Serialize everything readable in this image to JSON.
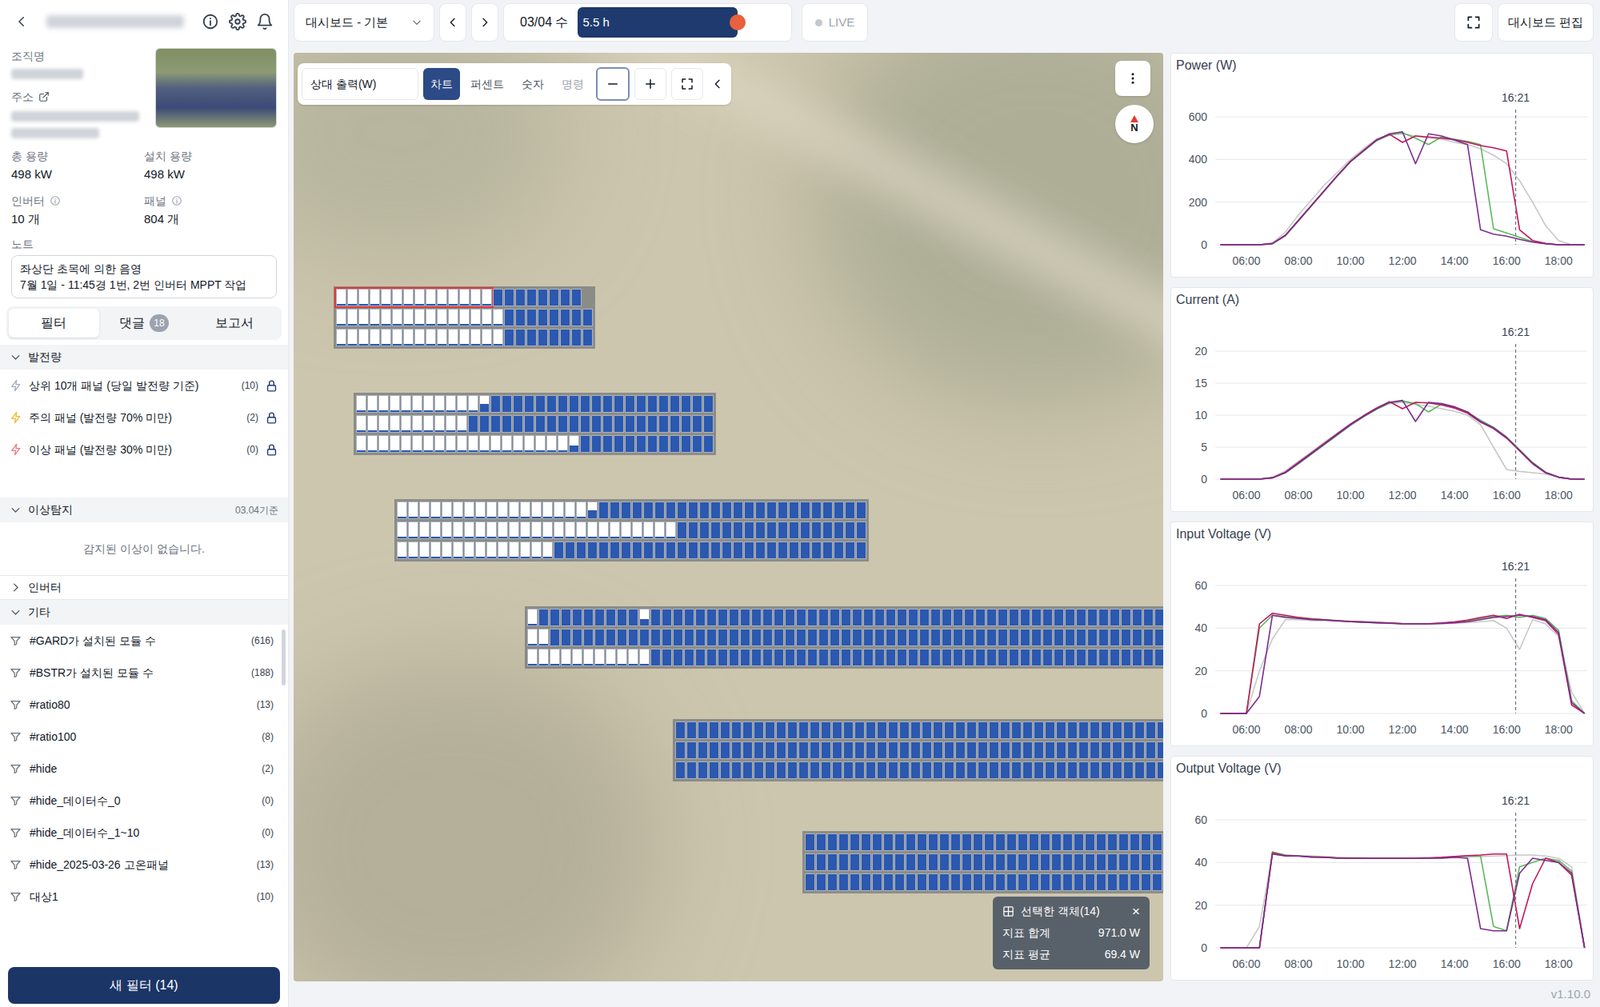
{
  "sidebar": {
    "org_label": "조직명",
    "address_label": "주소",
    "stats": [
      {
        "label": "총 용량",
        "value": "498 kW",
        "info": false
      },
      {
        "label": "설치 용량",
        "value": "498 kW",
        "info": false
      },
      {
        "label": "인버터",
        "value": "10 개",
        "info": true
      },
      {
        "label": "패널",
        "value": "804 개",
        "info": true
      }
    ],
    "note_label": "노트",
    "note_lines": [
      "좌상단 초목에 의한 음영",
      "7월 1일 - 11:45경 1번, 2번 인버터 MPPT 작업"
    ],
    "tabs": [
      {
        "label": "필터",
        "badge": "",
        "selected": true
      },
      {
        "label": "댓글",
        "badge": "18",
        "selected": false
      },
      {
        "label": "보고서",
        "badge": "",
        "selected": false
      }
    ],
    "power_section": {
      "title": "발전량",
      "expanded": true,
      "items": [
        {
          "label": "상위 10개 패널 (당일 발전량 기준)",
          "count": "(10)",
          "color": "#a3aec4",
          "locked": true
        },
        {
          "label": "주의 패널 (발전량 70% 미만)",
          "count": "(2)",
          "color": "#f5b82e",
          "locked": true
        },
        {
          "label": "이상 패널 (발전량 30% 미만)",
          "count": "(0)",
          "color": "#f07a7a",
          "locked": true
        }
      ]
    },
    "anomaly_section": {
      "title": "이상탐지",
      "expanded": true,
      "date": "03.04기준",
      "message": "감지된 이상이 없습니다."
    },
    "inverter_section": {
      "title": "인버터",
      "expanded": false
    },
    "etc_section": {
      "title": "기타",
      "expanded": true,
      "items": [
        {
          "label": "#GARD가 설치된 모듈 수",
          "count": "(616)"
        },
        {
          "label": "#BSTR가 설치된 모듈 수",
          "count": "(188)"
        },
        {
          "label": "#ratio80",
          "count": "(13)"
        },
        {
          "label": "#ratio100",
          "count": "(8)"
        },
        {
          "label": "#hide",
          "count": "(2)"
        },
        {
          "label": "#hide_데이터수_0",
          "count": "(0)"
        },
        {
          "label": "#hide_데이터수_1~10",
          "count": "(0)"
        },
        {
          "label": "#hide_2025-03-26 고온패널",
          "count": "(13)"
        },
        {
          "label": "대상1",
          "count": "(10)"
        }
      ]
    },
    "new_filter_button": "새 필터 (14)"
  },
  "topbar": {
    "dashboard": "대시보드 - 기본",
    "date": "03/04 수",
    "slider": {
      "reading": "5.5 h",
      "level": 0.81
    },
    "live": {
      "label": "LIVE",
      "on": false
    },
    "edit": "대시보드 편집"
  },
  "map": {
    "toolbar": {
      "metric": "상대 출력(W)",
      "modes": [
        {
          "label": "차트",
          "selected": true,
          "disabled": false
        },
        {
          "label": "퍼센트",
          "selected": false,
          "disabled": false
        },
        {
          "label": "숫자",
          "selected": false,
          "disabled": false
        },
        {
          "label": "명령",
          "selected": false,
          "disabled": true
        }
      ],
      "zoom_out_focused": true
    },
    "compass": "N",
    "arrays": [
      {
        "rows": [
          [
            {
              "count": 14,
              "level": 0.12,
              "selected": true
            },
            {
              "count": 8,
              "level": 1,
              "selected": false
            }
          ],
          [
            {
              "count": 15,
              "level": 0.12,
              "selected": false
            },
            {
              "count": 8,
              "level": 1,
              "selected": false
            }
          ],
          [
            {
              "count": 15,
              "level": 0.1,
              "selected": false
            },
            {
              "count": 8,
              "level": 1,
              "selected": false
            }
          ]
        ]
      },
      {
        "rows": [
          [
            {
              "count": 11,
              "level": 0.1,
              "selected": false
            },
            {
              "count": 1,
              "level": 0.5,
              "selected": false
            },
            {
              "count": 20,
              "level": 1,
              "selected": false
            }
          ],
          [
            {
              "count": 10,
              "level": 0.12,
              "selected": false
            },
            {
              "count": 22,
              "level": 1,
              "selected": false
            }
          ],
          [
            {
              "count": 19,
              "level": 0.1,
              "selected": false
            },
            {
              "count": 1,
              "level": 0.4,
              "selected": false
            },
            {
              "count": 12,
              "level": 1,
              "selected": false
            }
          ]
        ]
      },
      {
        "rows": [
          [
            {
              "count": 17,
              "level": 0.1,
              "selected": false
            },
            {
              "count": 1,
              "level": 0.5,
              "selected": false
            },
            {
              "count": 24,
              "level": 1,
              "selected": false
            }
          ],
          [
            {
              "count": 25,
              "level": 0.12,
              "selected": false
            },
            {
              "count": 17,
              "level": 1,
              "selected": false
            }
          ],
          [
            {
              "count": 14,
              "level": 0.1,
              "selected": false
            },
            {
              "count": 28,
              "level": 1,
              "selected": false
            }
          ]
        ]
      },
      {
        "rows": [
          [
            {
              "count": 1,
              "level": 0.1,
              "selected": false
            },
            {
              "count": 9,
              "level": 1,
              "selected": false
            },
            {
              "count": 1,
              "level": 0.4,
              "selected": false
            },
            {
              "count": 46,
              "level": 1,
              "selected": false
            }
          ],
          [
            {
              "count": 2,
              "level": 0.1,
              "selected": false
            },
            {
              "count": 55,
              "level": 1,
              "selected": false
            }
          ],
          [
            {
              "count": 11,
              "level": 0.1,
              "selected": false
            },
            {
              "count": 46,
              "level": 1,
              "selected": false
            }
          ]
        ]
      },
      {
        "rows": [
          [
            {
              "count": 44,
              "level": 1,
              "selected": false
            }
          ],
          [
            {
              "count": 44,
              "level": 1,
              "selected": false
            }
          ],
          [
            {
              "count": 44,
              "level": 1,
              "selected": false
            }
          ]
        ]
      },
      {
        "rows": [
          [
            {
              "count": 32,
              "level": 1,
              "selected": false
            }
          ],
          [
            {
              "count": 32,
              "level": 1,
              "selected": false
            }
          ],
          [
            {
              "count": 32,
              "level": 1,
              "selected": false
            }
          ]
        ]
      }
    ],
    "selection": {
      "title": "선택한 객체(14)",
      "close": "×",
      "rows": [
        {
          "label": "지표 합계",
          "value": "971.0 W"
        },
        {
          "label": "지표 평균",
          "value": "69.4 W"
        }
      ]
    }
  },
  "charts": [
    {
      "title": "Power (W)",
      "y_ticks": [
        "0",
        "200",
        "400",
        "600"
      ],
      "x_ticks": [
        "06:00",
        "08:00",
        "10:00",
        "12:00",
        "14:00",
        "16:00",
        "18:00"
      ],
      "cursor": "16:21",
      "series": [
        {
          "color": "#c8c8c8",
          "values": [
            0,
            0,
            0,
            0,
            8,
            60,
            140,
            210,
            280,
            340,
            400,
            450,
            495,
            515,
            520,
            510,
            500,
            495,
            480,
            470,
            450,
            420,
            380,
            300,
            200,
            90,
            20,
            0,
            0
          ]
        },
        {
          "color": "#5cb85c",
          "values": [
            0,
            0,
            0,
            0,
            5,
            42,
            112,
            182,
            252,
            322,
            388,
            438,
            488,
            515,
            525,
            500,
            470,
            505,
            495,
            485,
            470,
            75,
            55,
            35,
            15,
            5,
            0,
            0,
            0
          ]
        },
        {
          "color": "#c2185b",
          "values": [
            0,
            0,
            0,
            0,
            6,
            44,
            114,
            184,
            254,
            324,
            392,
            442,
            492,
            518,
            480,
            510,
            505,
            500,
            492,
            480,
            465,
            455,
            440,
            70,
            20,
            6,
            0,
            0,
            0
          ]
        },
        {
          "color": "#7b2d8e",
          "values": [
            0,
            0,
            0,
            0,
            5,
            45,
            115,
            185,
            255,
            325,
            390,
            440,
            490,
            520,
            530,
            380,
            520,
            510,
            490,
            470,
            70,
            50,
            40,
            25,
            12,
            5,
            0,
            0,
            0
          ]
        }
      ]
    },
    {
      "title": "Current (A)",
      "y_ticks": [
        "0",
        "5",
        "10",
        "15",
        "20"
      ],
      "x_ticks": [
        "06:00",
        "08:00",
        "10:00",
        "12:00",
        "14:00",
        "16:00",
        "18:00"
      ],
      "cursor": "16:21",
      "series": [
        {
          "color": "#c8c8c8",
          "values": [
            0,
            0,
            0,
            0,
            0.3,
            1.3,
            2.8,
            4.2,
            5.8,
            7.2,
            8.6,
            9.9,
            11,
            11.8,
            12,
            11.7,
            11.4,
            11,
            10.6,
            10,
            8.5,
            5,
            1.5,
            1.2,
            1,
            0.8,
            0.3,
            0,
            0
          ]
        },
        {
          "color": "#5cb85c",
          "values": [
            0,
            0,
            0,
            0,
            0.2,
            1,
            2.4,
            3.9,
            5.4,
            6.9,
            8.4,
            9.7,
            10.9,
            11.9,
            12.2,
            11.8,
            10.5,
            11.7,
            11.2,
            10.4,
            9.2,
            8.1,
            6.6,
            4.6,
            2.6,
            1.1,
            0.3,
            0,
            0
          ]
        },
        {
          "color": "#c2185b",
          "values": [
            0,
            0,
            0,
            0,
            0.2,
            1.1,
            2.6,
            4.1,
            5.6,
            7.1,
            8.6,
            9.9,
            11.1,
            12.1,
            11,
            12,
            11.9,
            11.6,
            11.1,
            10.3,
            8.9,
            7.9,
            6.4,
            4.4,
            2.4,
            1,
            0.3,
            0,
            0
          ]
        },
        {
          "color": "#7b2d8e",
          "values": [
            0,
            0,
            0,
            0,
            0.2,
            1,
            2.5,
            4,
            5.5,
            7,
            8.5,
            9.8,
            11,
            12,
            12.3,
            9,
            12,
            11.8,
            11.3,
            10.5,
            9,
            8,
            6.5,
            4.5,
            2.5,
            1,
            0.3,
            0,
            0
          ]
        }
      ]
    },
    {
      "title": "Input Voltage (V)",
      "y_ticks": [
        "0",
        "20",
        "40",
        "60"
      ],
      "x_ticks": [
        "06:00",
        "08:00",
        "10:00",
        "12:00",
        "14:00",
        "16:00",
        "18:00"
      ],
      "cursor": "16:21",
      "series": [
        {
          "color": "#c8c8c8",
          "values": [
            0,
            0,
            0,
            20,
            35,
            44,
            44,
            43.5,
            43.5,
            43.2,
            43,
            42.8,
            42.5,
            42.3,
            42,
            42,
            42,
            42,
            42.3,
            42.6,
            43,
            43.5,
            40,
            30,
            44,
            42,
            36,
            10,
            0
          ]
        },
        {
          "color": "#5cb85c",
          "values": [
            0,
            0,
            0,
            40,
            46,
            45.5,
            45,
            44.5,
            44,
            43.6,
            43.2,
            43,
            42.7,
            42.5,
            42.2,
            42.1,
            42,
            42.3,
            42.8,
            43.5,
            44.5,
            45.5,
            46,
            45,
            46,
            44.5,
            39,
            6,
            0
          ]
        },
        {
          "color": "#c2185b",
          "values": [
            0,
            0,
            0,
            42,
            47,
            46,
            45,
            44.2,
            43.9,
            43.4,
            43.1,
            42.9,
            42.6,
            42.4,
            42.1,
            42,
            42.1,
            42.4,
            42.9,
            43.8,
            45,
            46,
            44.5,
            46.5,
            45,
            43.5,
            37,
            4,
            0
          ]
        },
        {
          "color": "#7b2d8e",
          "values": [
            0,
            0,
            0,
            8,
            46,
            45,
            44.5,
            44,
            43.8,
            43.5,
            43,
            42.8,
            42.5,
            42.3,
            42,
            42,
            42,
            42.2,
            42.5,
            43,
            44,
            45,
            45.5,
            46,
            45.5,
            44,
            38,
            5,
            0
          ]
        }
      ]
    },
    {
      "title": "Output Voltage (V)",
      "y_ticks": [
        "0",
        "20",
        "40",
        "60"
      ],
      "x_ticks": [
        "06:00",
        "08:00",
        "10:00",
        "12:00",
        "14:00",
        "16:00",
        "18:00"
      ],
      "cursor": "16:21",
      "series": [
        {
          "color": "#c8c8c8",
          "values": [
            0,
            0,
            0,
            10,
            44,
            43.5,
            43.2,
            43,
            42.8,
            42.5,
            42.3,
            42.2,
            42,
            42,
            42,
            42,
            42,
            42,
            42.2,
            42.5,
            42.8,
            43,
            43.2,
            43.5,
            43.5,
            43,
            42,
            38,
            0
          ]
        },
        {
          "color": "#5cb85c",
          "values": [
            0,
            0,
            0,
            0,
            45,
            43.5,
            43,
            42.8,
            42.5,
            42.2,
            42,
            42,
            42,
            42,
            42,
            42,
            42,
            42.3,
            42.6,
            43,
            43,
            10,
            8,
            38,
            40,
            42,
            41,
            36,
            0
          ]
        },
        {
          "color": "#c2185b",
          "values": [
            0,
            0,
            0,
            0,
            44.5,
            43.2,
            43,
            42.6,
            42.4,
            42.1,
            42,
            42,
            42,
            42,
            42,
            42.1,
            42.2,
            42.4,
            42.8,
            43.2,
            43.5,
            44,
            44,
            9,
            30,
            42,
            40,
            34,
            0
          ]
        },
        {
          "color": "#7b2d8e",
          "values": [
            0,
            0,
            0,
            0,
            44,
            43,
            43,
            42.5,
            42.5,
            42,
            42,
            42,
            42,
            42,
            42,
            42,
            42,
            42,
            42.5,
            42,
            9,
            8,
            8,
            35,
            42,
            41,
            40,
            35,
            0
          ]
        }
      ]
    }
  ],
  "version": "v1.10.0"
}
